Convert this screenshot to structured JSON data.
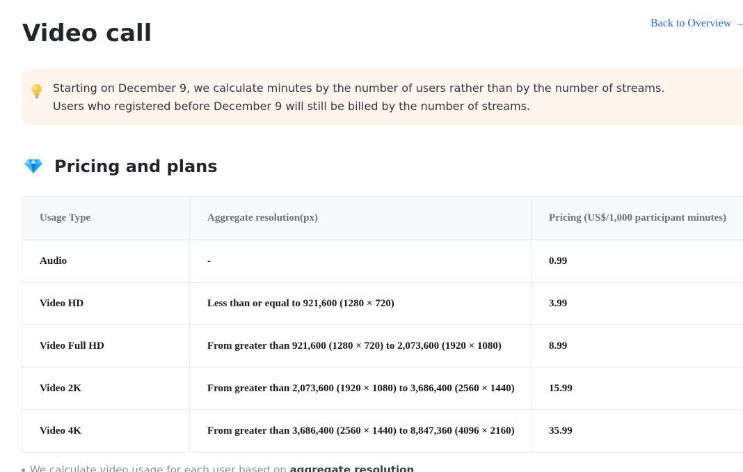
{
  "page": {
    "title": "Video call",
    "back_link": "Back to Overview",
    "back_arrow": "→"
  },
  "notice": {
    "icon": "lightbulb-icon",
    "line1": "Starting on December 9, we calculate minutes by the number of users rather than by the number of streams.",
    "line2": "Users who registered before December 9 will still be billed by the number of streams."
  },
  "section": {
    "icon": "diamond-icon",
    "title": "Pricing and plans"
  },
  "table": {
    "headers": [
      "Usage Type",
      "Aggregate resolution(px)",
      "Pricing (US$/1,000 participant minutes)"
    ],
    "rows": [
      [
        "Audio",
        "-",
        "0.99"
      ],
      [
        "Video HD",
        "Less than or equal to 921,600 (1280 × 720)",
        "3.99"
      ],
      [
        "Video Full HD",
        "From greater than 921,600 (1280 × 720) to 2,073,600 (1920 × 1080)",
        "8.99"
      ],
      [
        "Video 2K",
        "From greater than 2,073,600 (1920 × 1080) to 3,686,400 (2560 × 1440)",
        "15.99"
      ],
      [
        "Video 4K",
        "From greater than 3,686,400 (2560 × 1440) to 8,847,360 (4096 × 2160)",
        "35.99"
      ]
    ]
  },
  "footnote": {
    "text": "We calculate video usage for each user based on ",
    "bold": "aggregate resolution"
  },
  "colors": {
    "link": "#1f63d6",
    "notice_bg": "#fff5ec",
    "header_bg": "#f8f9fb",
    "border": "#e7e9ee"
  }
}
